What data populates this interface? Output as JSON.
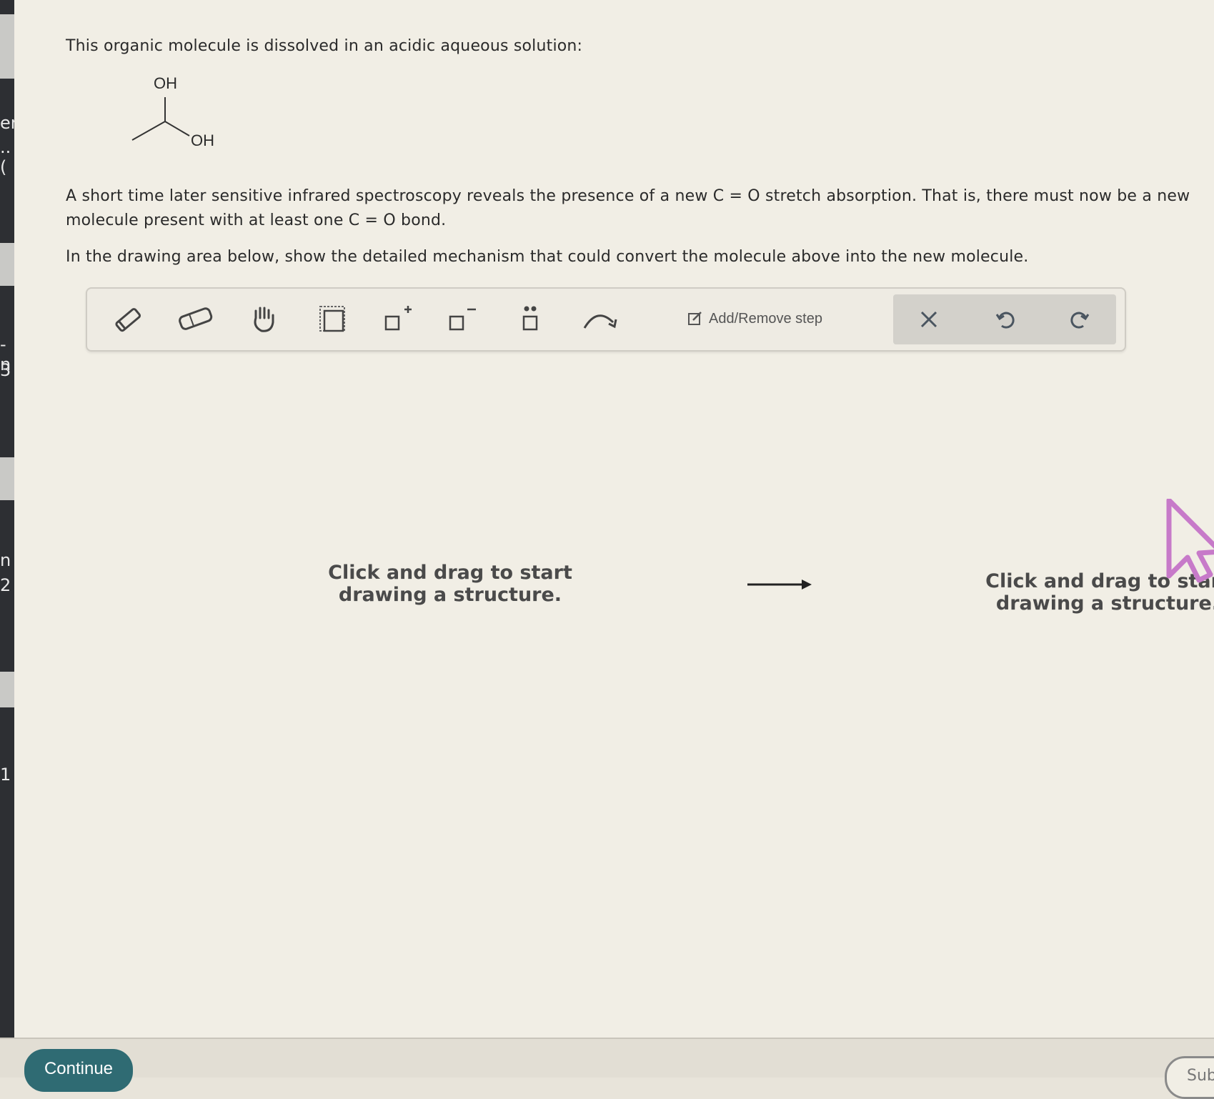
{
  "left_fragments": [
    "en",
    "..(",
    "-n",
    "3",
    "n",
    "2",
    "1"
  ],
  "question": {
    "intro": "This organic molecule is dissolved in an acidic aqueous solution:",
    "body": "A short time later sensitive infrared spectroscopy reveals the presence of a new C = O stretch absorption. That is, there must now be a new molecule present with at least one C = O bond.",
    "instruction": "In the drawing area below, show the detailed mechanism that could convert the molecule above into the new molecule."
  },
  "molecule": {
    "label_top": "OH",
    "label_right": "OH"
  },
  "toolbar": {
    "tools": [
      "pencil-icon",
      "eraser-icon",
      "hand-icon",
      "select-box-icon",
      "positive-charge-icon",
      "negative-charge-icon",
      "lone-pair-icon",
      "curved-arrow-icon"
    ],
    "add_remove_step": "Add/Remove step",
    "clear": "clear-icon",
    "undo": "undo-icon",
    "redo": "redo-icon"
  },
  "canvas": {
    "left_prompt": "Click and drag to start drawing a structure.",
    "right_prompt": "Click and drag to start drawing a structure."
  },
  "footer": {
    "continue_label": "Continue",
    "submit_label": "Sub"
  }
}
